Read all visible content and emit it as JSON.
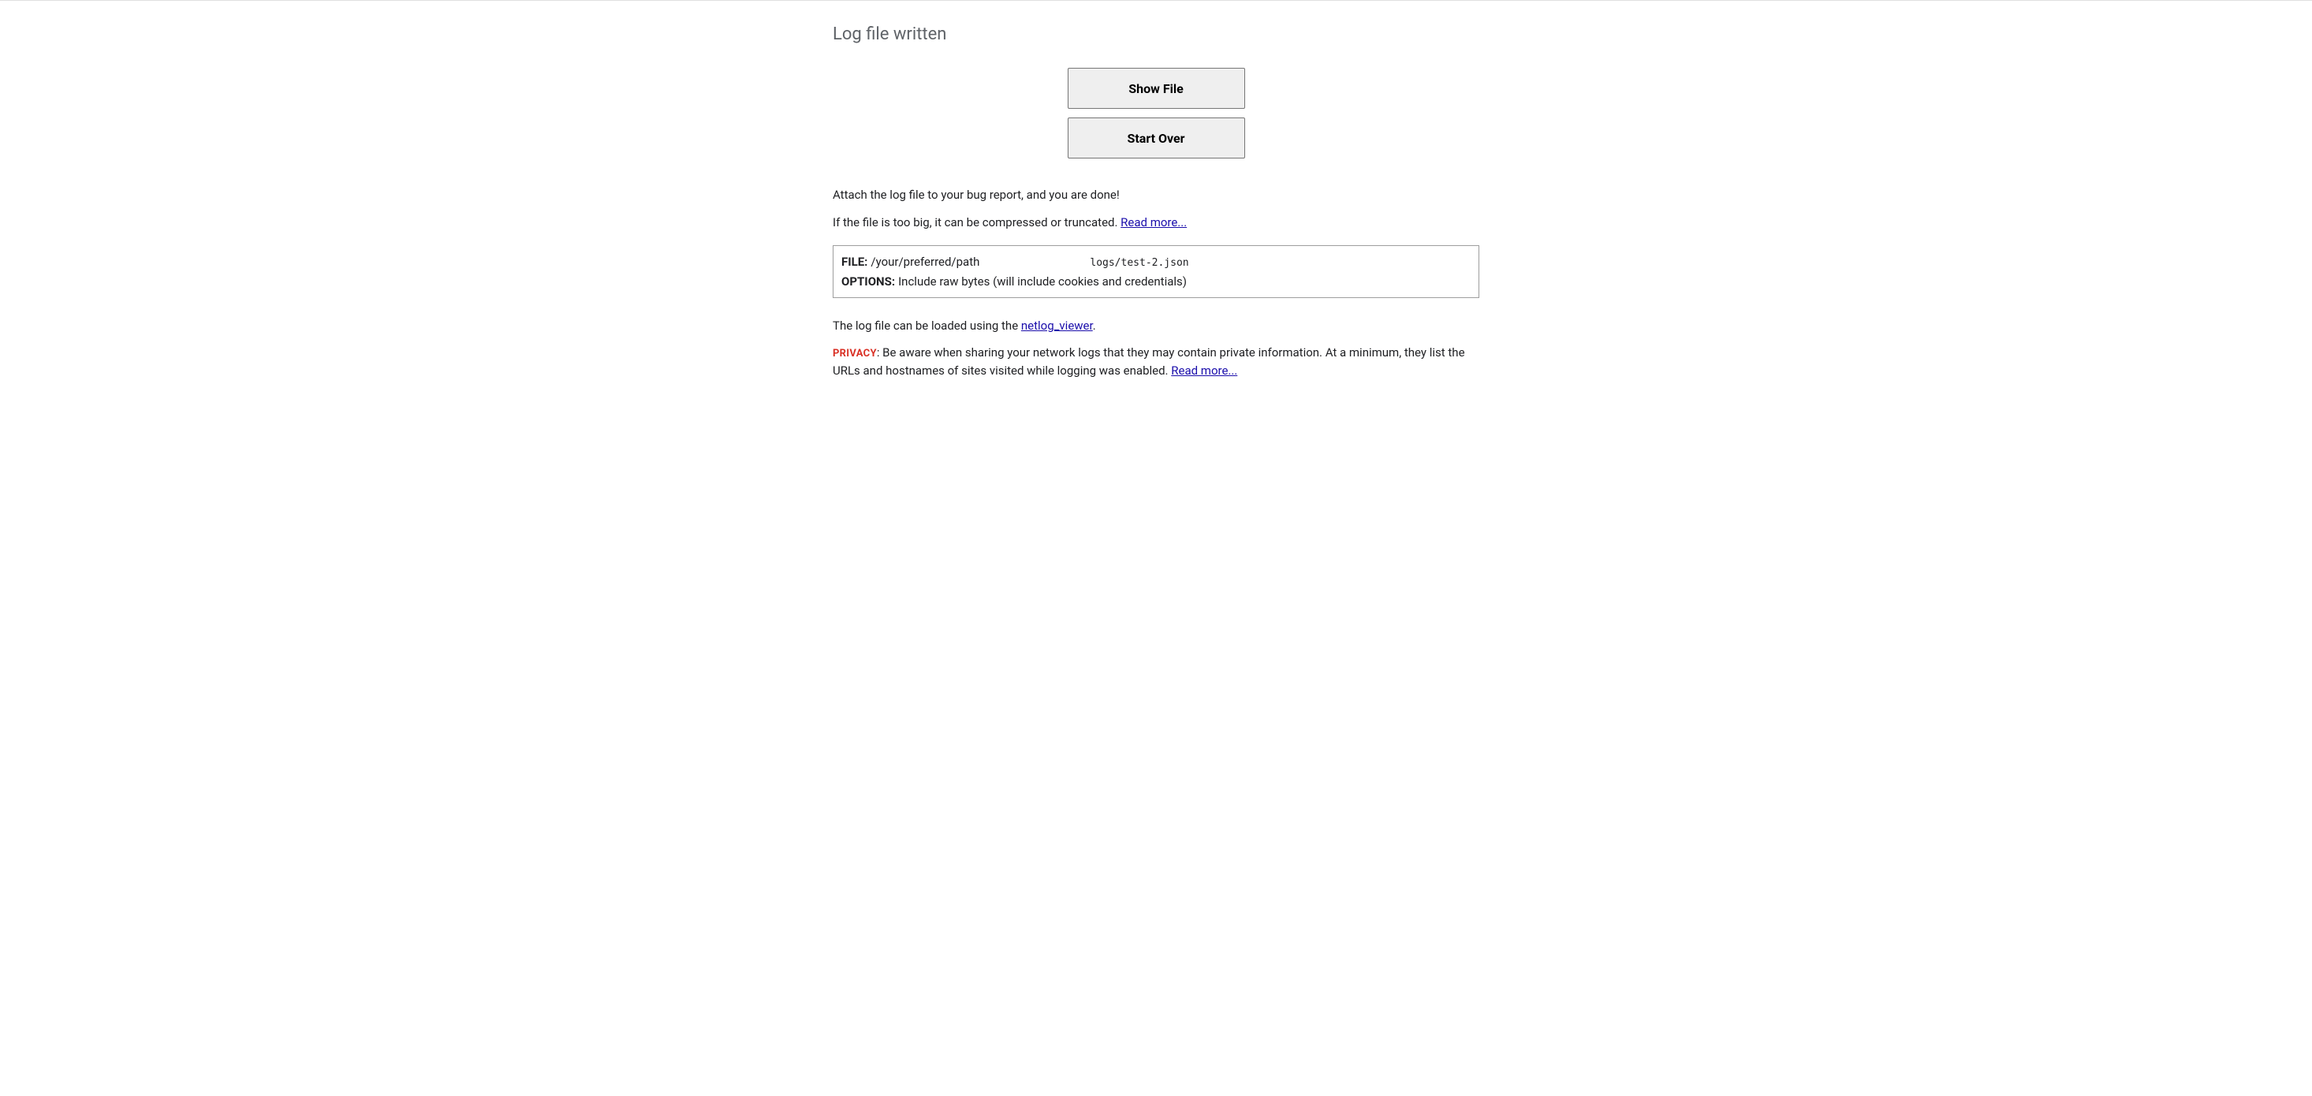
{
  "title": "Log file written",
  "buttons": {
    "show_file": "Show File",
    "start_over": "Start Over"
  },
  "instructions": {
    "attach": "Attach the log file to your bug report, and you are done!",
    "too_big_prefix": "If the file is too big, it can be compressed or truncated. ",
    "read_more": "Read more..."
  },
  "file_info": {
    "file_label": "FILE:",
    "file_path": "/your/preferred/path",
    "file_name": "logs/test-2.json",
    "options_label": "OPTIONS:",
    "options_value": "Include raw bytes (will include cookies and credentials)"
  },
  "viewer": {
    "prefix": "The log file can be loaded using the ",
    "link": "netlog_viewer",
    "suffix": "."
  },
  "privacy": {
    "label": "PRIVACY",
    "text": ": Be aware when sharing your network logs that they may contain private information. At a minimum, they list the URLs and hostnames of sites visited while logging was enabled. ",
    "read_more": "Read more..."
  }
}
